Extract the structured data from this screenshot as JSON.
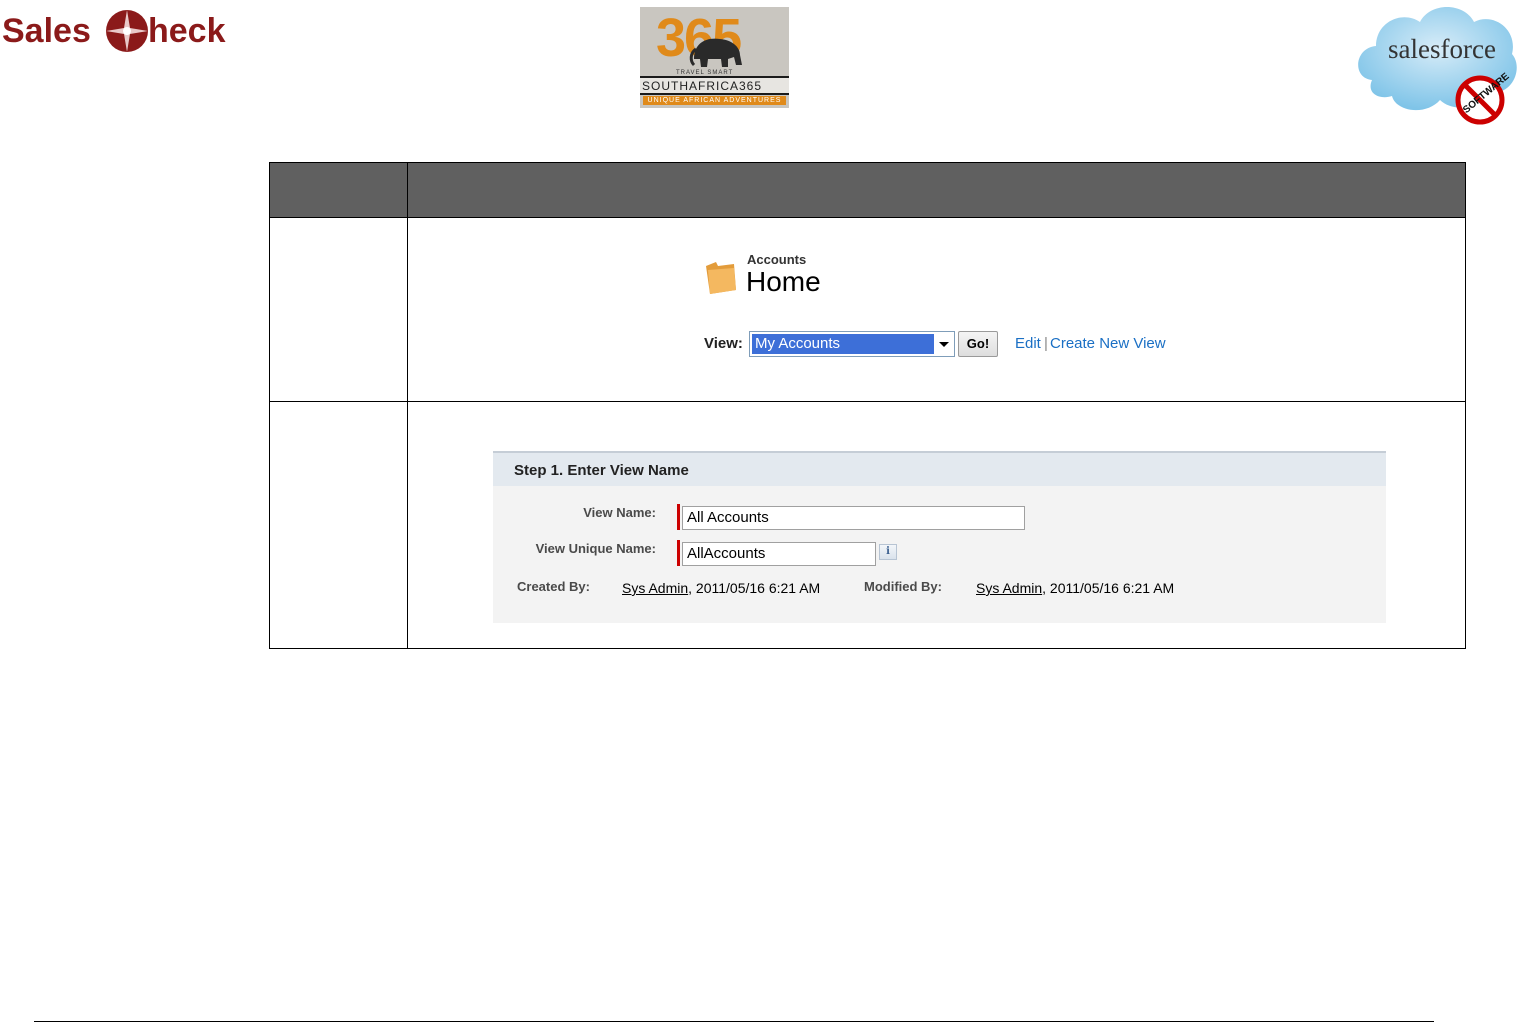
{
  "logos": {
    "salescheck": {
      "left": "Sales",
      "right": "heck"
    },
    "southafrica365": {
      "number": "365",
      "tagline": "TRAVEL SMART",
      "name": "SOUTHAFRICA365",
      "bottom": "UNIQUE AFRICAN ADVENTURES"
    },
    "salesforce": {
      "word": "salesforce",
      "badge": "SOFTWARE"
    }
  },
  "accounts_home": {
    "object_label": "Accounts",
    "page_title": "Home",
    "view_label": "View:",
    "view_selected": "My Accounts",
    "go_label": "Go!",
    "edit_link": "Edit",
    "separator": "|",
    "create_link": "Create New View"
  },
  "step1": {
    "title": "Step 1. Enter View Name",
    "view_name_label": "View Name:",
    "view_name_value": "All Accounts",
    "unique_name_label": "View Unique Name:",
    "unique_name_value": "AllAccounts",
    "info_icon": "i",
    "created_by_label": "Created By:",
    "created_by_user": "Sys Admin",
    "created_by_date": ", 2011/05/16 6:21 AM",
    "modified_by_label": "Modified By:",
    "modified_by_user": "Sys Admin",
    "modified_by_date": ", 2011/05/16 6:21 AM"
  }
}
